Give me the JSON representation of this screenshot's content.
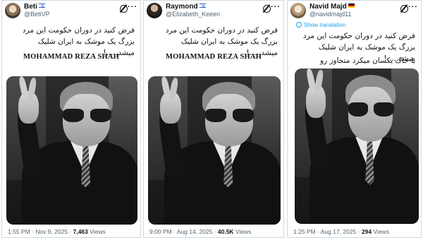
{
  "tweets": [
    {
      "name": "Beti",
      "flag": "il",
      "handle": "@BetiVP",
      "text": "فرض کنید در دوران حکومت این مرد بزرگ یک موشک به ایران شلیک میشد.....!",
      "signature": "MOHAMMAD REZA SHAH",
      "translation_label": "",
      "second_text": "",
      "time": "1:55 PM · Nov 9, 2025 · ",
      "views": "7,463",
      "views_label": " Views"
    },
    {
      "name": "Raymond",
      "flag": "il",
      "handle": "@Elizabeth_Keeen",
      "text": "فرض کنید در دوران حکومت این مرد بزرگ یک موشک به ایران شلیک میشد.....!",
      "signature": "MOHAMMAD REZA SHAH",
      "translation_label": "",
      "second_text": "",
      "time": "9:00 PM · Aug 14, 2025 · ",
      "views": "40.5K",
      "views_label": " Views"
    },
    {
      "name": "Navid Majd",
      "flag": "de",
      "handle": "@navidmajd11",
      "text": "فرض کنید در دوران حکومت این مرد بزرگ یک موشک به ایران شلیک میشد.....!",
      "signature": "",
      "translation_label": "Show translation",
      "second_text": "با خاک یکسان میکرد متجاوز رو",
      "time": "1:25 PM · Aug 17, 2025 · ",
      "views": "294",
      "views_label": " Views"
    }
  ],
  "icons": {
    "verified": "verified-badge-icon",
    "grok": "grok-icon",
    "more": "more-icon",
    "translate": "globe-icon"
  },
  "colors": {
    "text": "#0f1419",
    "muted": "#536471",
    "link": "#1d9bf0",
    "border": "#cfd9de"
  }
}
